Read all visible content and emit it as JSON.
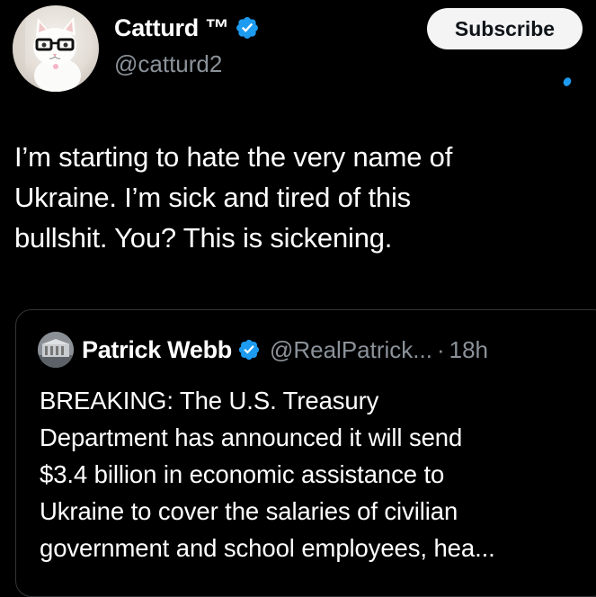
{
  "author": {
    "name": "Catturd ™",
    "handle": "@catturd2",
    "verified_icon": "verified-badge-icon",
    "avatar_icon": "cat-with-glasses-avatar"
  },
  "subscribe_label": "Subscribe",
  "tweet": {
    "text": "I’m starting to hate the very name of\nUkraine. I’m sick and tired of this\nbullshit. You? This is sickening."
  },
  "quote": {
    "name": "Patrick Webb",
    "handle": "@RealPatrick...",
    "separator": "·",
    "time": "18h",
    "text": "BREAKING: The U.S. Treasury\nDepartment has announced it will send\n$3.4 billion in economic assistance to\nUkraine to cover the salaries of civilian\ngovernment and school employees, hea..."
  },
  "colors": {
    "background": "#000000",
    "text_primary": "#ffffff",
    "text_secondary": "#8b9299",
    "accent_blue": "#1d9bf0",
    "button_bg": "#f4f4f5",
    "card_border": "#333639"
  }
}
